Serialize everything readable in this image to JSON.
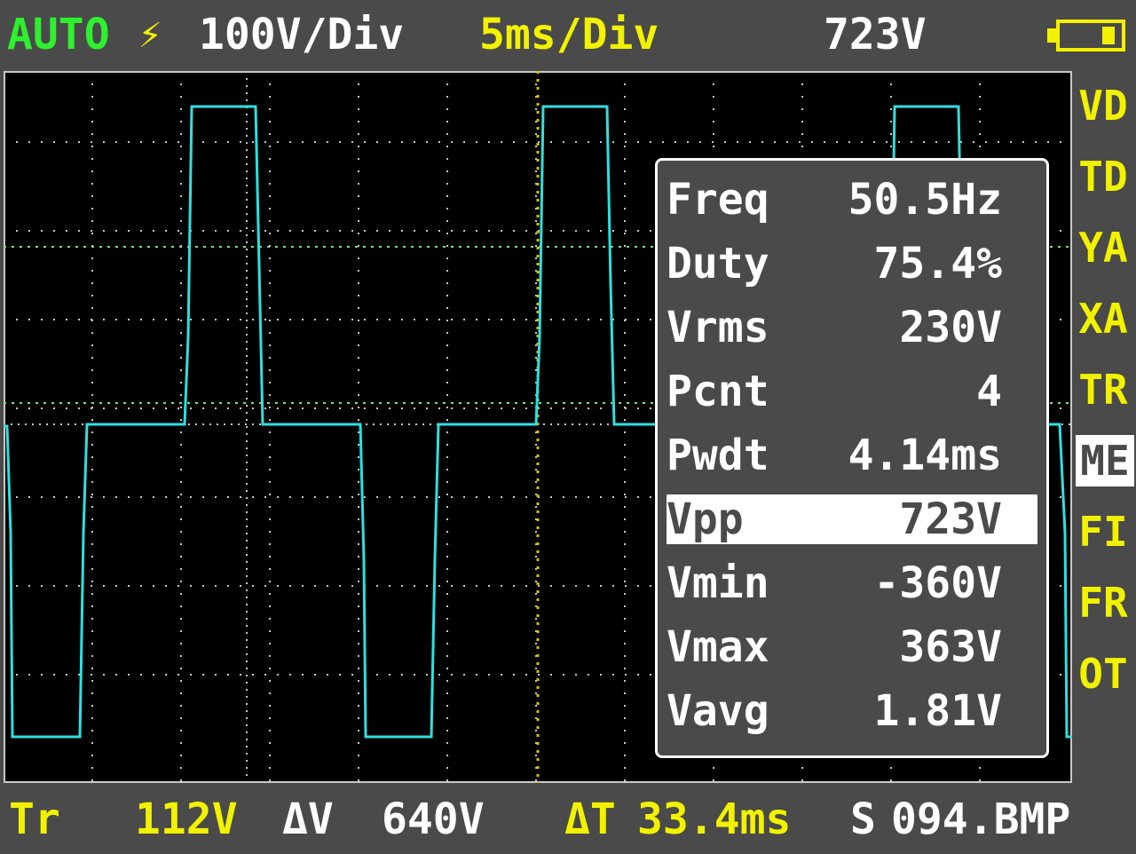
{
  "header": {
    "mode": "AUTO",
    "trigger_edge_icon": "trigger-edge-icon",
    "volts_per_div": "100V/Div",
    "time_per_div": "5ms/Div",
    "vpp_readout": "723V",
    "battery_icon": "battery-icon"
  },
  "menu": [
    {
      "label": "VD",
      "active": false
    },
    {
      "label": "TD",
      "active": false
    },
    {
      "label": "YA",
      "active": false
    },
    {
      "label": "XA",
      "active": false
    },
    {
      "label": "TR",
      "active": false
    },
    {
      "label": "ME",
      "active": true
    },
    {
      "label": "FI",
      "active": false
    },
    {
      "label": "FR",
      "active": false
    },
    {
      "label": "OT",
      "active": false
    }
  ],
  "measurements": [
    {
      "label": "Freq",
      "value": "50.5Hz",
      "selected": false
    },
    {
      "label": "Duty",
      "value": "75.4%",
      "selected": false
    },
    {
      "label": "Vrms",
      "value": "230V",
      "selected": false
    },
    {
      "label": "Pcnt",
      "value": "4",
      "selected": false
    },
    {
      "label": "Pwdt",
      "value": "4.14ms",
      "selected": false
    },
    {
      "label": "Vpp",
      "value": "723V",
      "selected": true
    },
    {
      "label": "Vmin",
      "value": "-360V",
      "selected": false
    },
    {
      "label": "Vmax",
      "value": "363V",
      "selected": false
    },
    {
      "label": "Vavg",
      "value": "1.81V",
      "selected": false
    }
  ],
  "footer": {
    "trigger_label": "Tr",
    "trigger_level": "112V",
    "delta_v_label": "ΔV",
    "delta_v": "640V",
    "delta_t_label": "ΔT",
    "delta_t": "33.4ms",
    "save_label": "S",
    "save_file": "094.BMP"
  },
  "colors": {
    "trace": "#2ee0e0",
    "cursor_green": "#7ee07e",
    "cursor_yellow": "#e0c000",
    "grid": "#c8c8c8",
    "accent_yellow": "#f2f200",
    "accent_green": "#2ef02e"
  }
}
